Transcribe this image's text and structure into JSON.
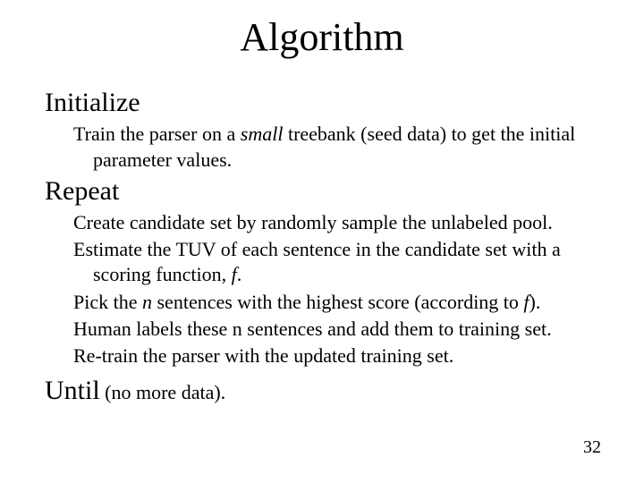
{
  "title": "Algorithm",
  "initialize": {
    "heading": "Initialize",
    "line1_a": "Train the parser on a ",
    "line1_b": "small",
    "line1_c": " treebank (seed data) to get the initial parameter values."
  },
  "repeat": {
    "heading": "Repeat",
    "step1": "Create candidate set by randomly sample the unlabeled pool.",
    "step2_a": "Estimate the TUV of each sentence in the candidate set with a scoring function, ",
    "step2_b": "f",
    "step2_c": ".",
    "step3_a": "Pick the ",
    "step3_b": "n",
    "step3_c": " sentences with the highest score (according to ",
    "step3_d": "f",
    "step3_e": ").",
    "step4": "Human labels these n sentences and add them to training set.",
    "step5": "Re-train the parser with the updated training set."
  },
  "until": {
    "keyword": "Until",
    "cond": " (no more data)."
  },
  "page_number": "32"
}
